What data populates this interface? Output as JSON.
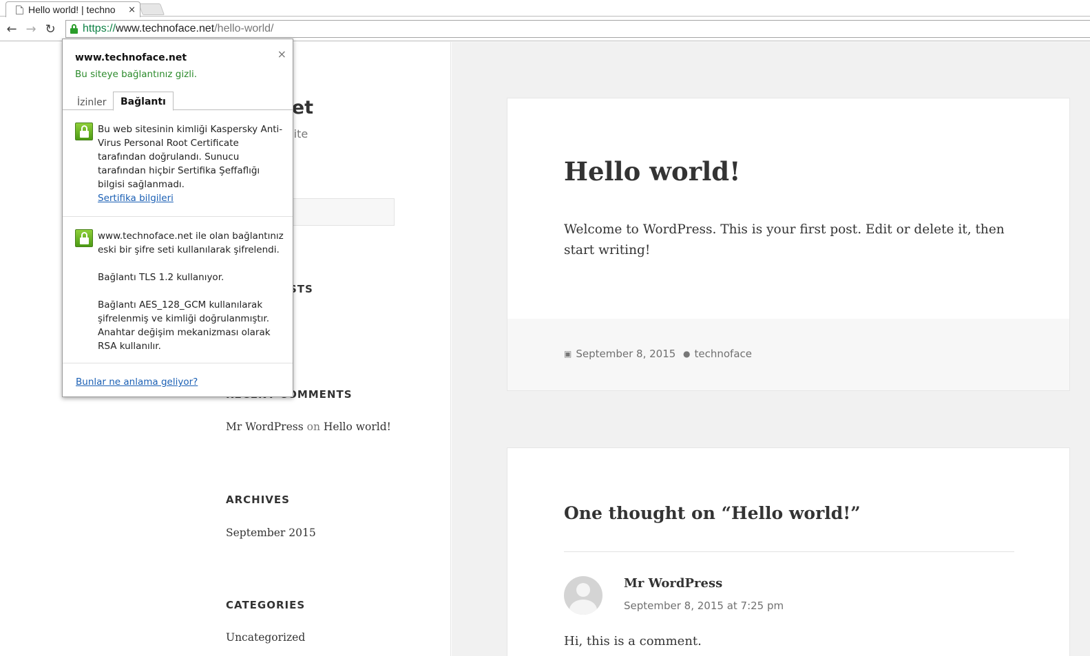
{
  "browser": {
    "tab_title": "Hello world! | techno",
    "tab_close": "×",
    "url_scheme": "https://",
    "url_host": "www.technoface.net",
    "url_path": "/hello-world/",
    "back_glyph": "←",
    "forward_glyph": "→",
    "reload_glyph": "↻"
  },
  "sidebar": {
    "site_title": "face.net",
    "site_description": "WordPress site",
    "recent_posts_partial": "STS",
    "recent_comments_partial": "RECENT COMMENTS",
    "comment_author": "Mr WordPress",
    "comment_on": "on",
    "comment_post": "Hello world!",
    "archives_title": "ARCHIVES",
    "archives_item": "September 2015",
    "categories_title": "CATEGORIES",
    "categories_item": "Uncategorized"
  },
  "post": {
    "title": "Hello world!",
    "body": "Welcome to WordPress. This is your first post. Edit or delete it, then start writing!",
    "date": "September 8, 2015",
    "author": "technoface"
  },
  "comments": {
    "title": "One thought on “Hello world!”",
    "author": "Mr WordPress",
    "date": "September 8, 2015 at 7:25 pm",
    "text": "Hi, this is a comment."
  },
  "popup": {
    "host": "www.technoface.net",
    "status": "Bu siteye bağlantınız gizli.",
    "close": "×",
    "tab_permissions": "İzinler",
    "tab_connection": "Bağlantı",
    "identity_text": "Bu web sitesinin kimliği Kaspersky Anti-Virus Personal Root Certificate tarafından doğrulandı. Sunucu tarafından hiçbir Sertifika Şeffaflığı bilgisi sağlanmadı.",
    "certificate_link": "Sertifika bilgileri",
    "encryption_text": "www.technoface.net ile olan bağlantınız eski bir şifre seti kullanılarak şifrelendi.",
    "tls_text": "Bağlantı TLS 1.2 kullanıyor.",
    "cipher_text": "Bağlantı AES_128_GCM kullanılarak şifrelenmiş ve kimliği doğrulanmıştır. Anahtar değişim mekanizması olarak RSA kullanılır.",
    "help_link": "Bunlar ne anlama geliyor?"
  },
  "icons": {
    "lock": "lock-icon",
    "calendar": "calendar-icon",
    "user": "user-icon"
  },
  "colors": {
    "secure_green": "#2b8a2b",
    "link_blue": "#1a5fb4",
    "page_bg": "#f1f1f1"
  }
}
